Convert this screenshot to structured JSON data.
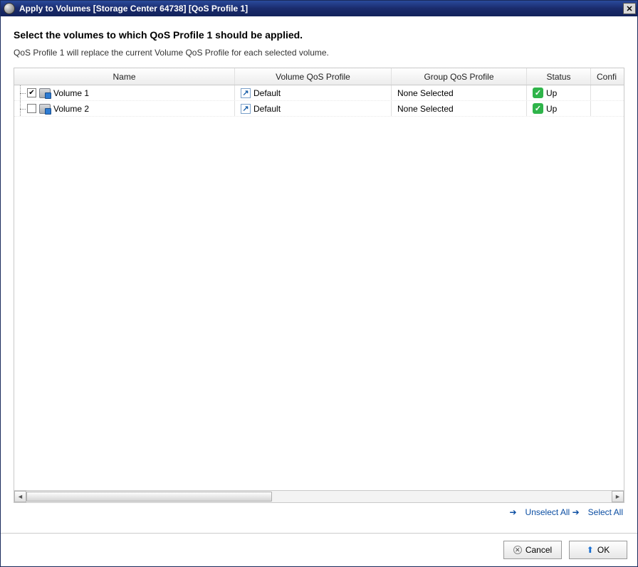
{
  "titlebar": {
    "title": "Apply to Volumes [Storage Center 64738] [QoS Profile 1]"
  },
  "heading": "Select the volumes to which QoS Profile 1 should be applied.",
  "subheading": "QoS Profile 1 will replace the current Volume QoS Profile for each selected volume.",
  "columns": {
    "name": "Name",
    "vqos": "Volume QoS Profile",
    "gqos": "Group QoS Profile",
    "status": "Status",
    "conf": "Confi"
  },
  "rows": [
    {
      "checked": true,
      "name": "Volume 1",
      "vqos": "Default",
      "gqos": "None Selected",
      "status": "Up"
    },
    {
      "checked": false,
      "name": "Volume 2",
      "vqos": "Default",
      "gqos": "None Selected",
      "status": "Up"
    }
  ],
  "links": {
    "unselect_all": "Unselect All",
    "select_all": "Select All"
  },
  "buttons": {
    "cancel": "Cancel",
    "ok": "OK"
  }
}
